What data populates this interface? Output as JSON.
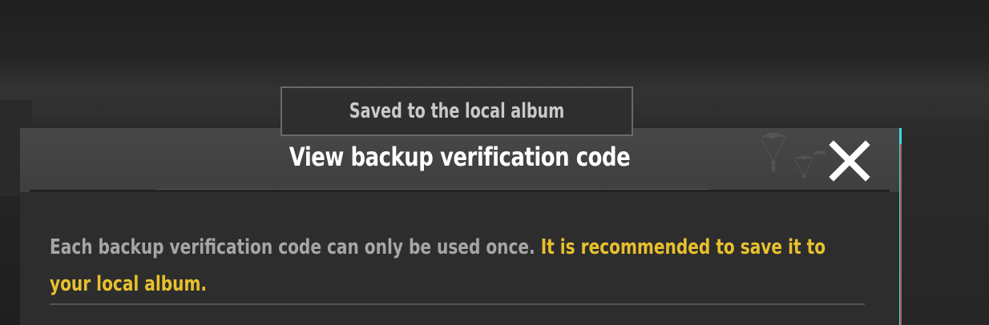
{
  "toast": {
    "message": "Saved to the local album"
  },
  "dialog": {
    "title": "View backup verification code",
    "close_icon": "close-x-icon",
    "decoration_icon": "parachutes-icon",
    "body": {
      "text_normal": "Each backup verification code can only be used once. ",
      "text_highlight": "It is recommended to save it to your local album."
    }
  },
  "colors": {
    "highlight": "#e8c02e",
    "accent_cyan": "#3fd6e0",
    "body_text": "#a6a6a6",
    "title_text": "#ffffff"
  }
}
